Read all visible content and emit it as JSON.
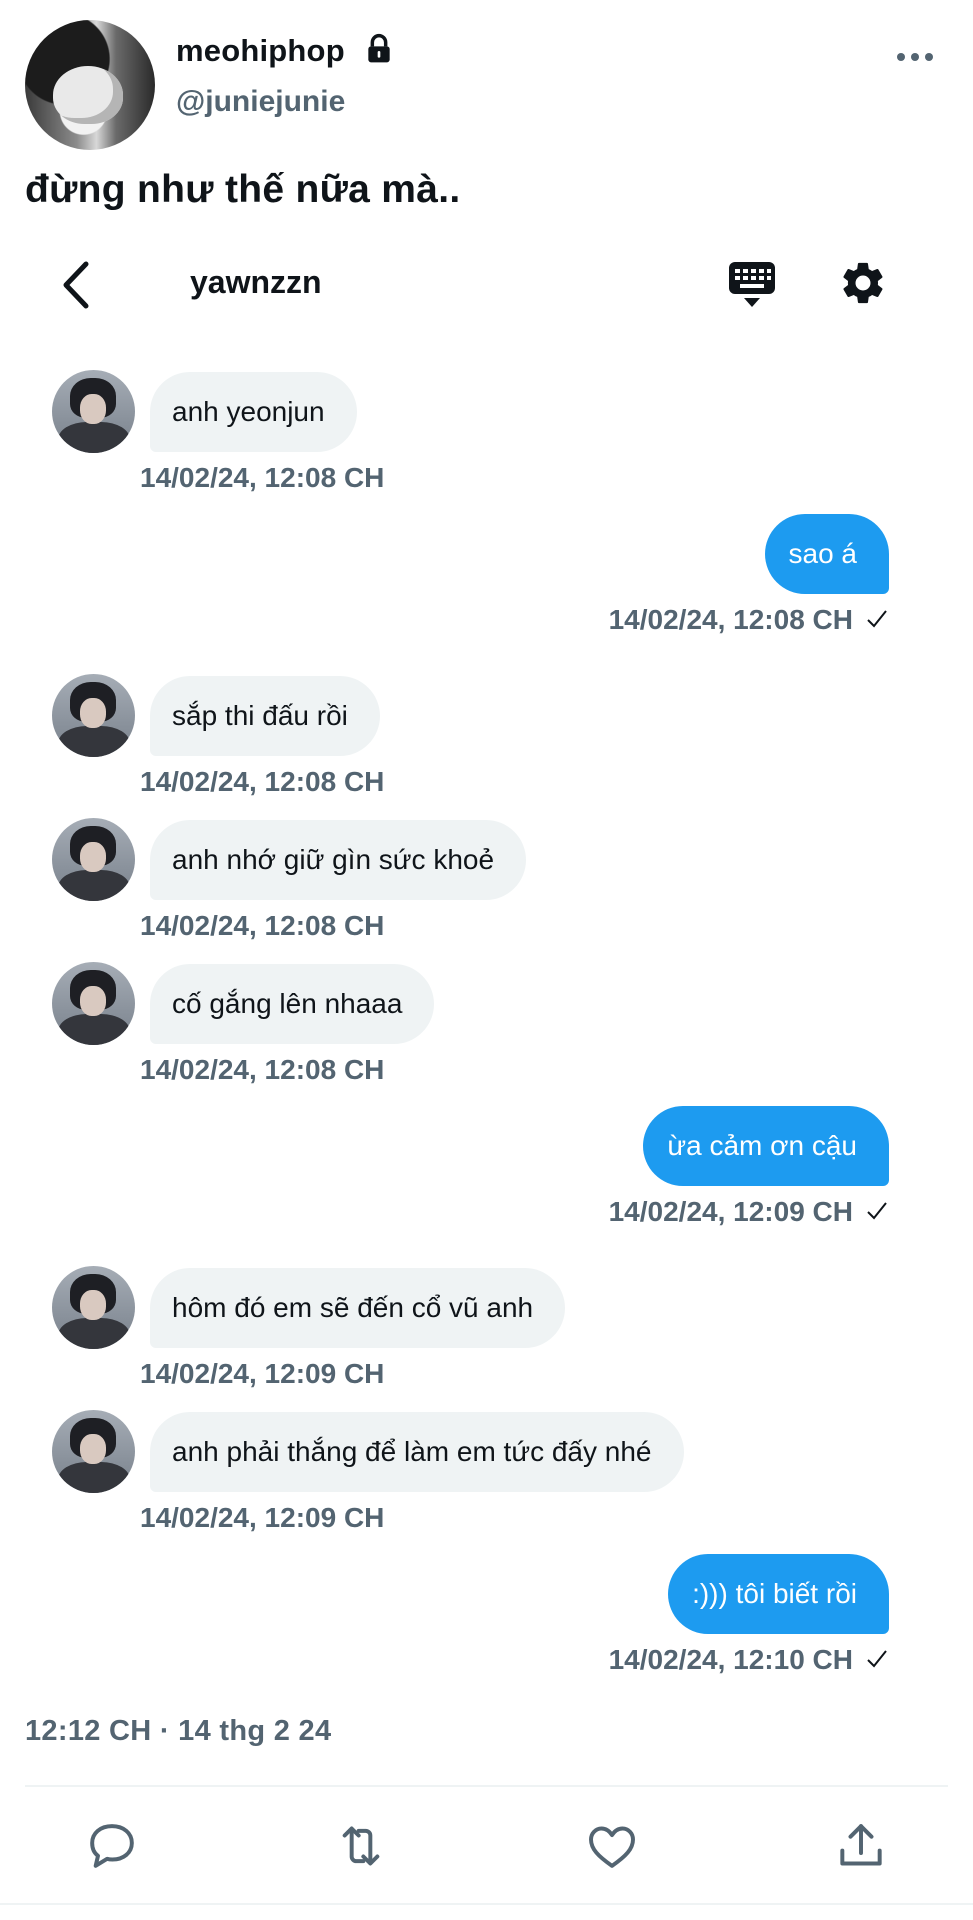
{
  "tweet": {
    "display_name": "meohiphop",
    "handle": "@juniejunie",
    "text": "đừng như thế nữa mà..",
    "timestamp": "12:12 CH · 14 thg 2 24"
  },
  "dm": {
    "title": "yawnzzn",
    "messages": [
      {
        "dir": "in",
        "text": "anh yeonjun",
        "time": "14/02/24, 12:08 CH"
      },
      {
        "dir": "out",
        "text": "sao á",
        "time": "14/02/24, 12:08 CH"
      },
      {
        "dir": "in",
        "text": "sắp thi đấu rồi",
        "time": "14/02/24, 12:08 CH"
      },
      {
        "dir": "in",
        "text": "anh nhớ giữ gìn sức khoẻ",
        "time": "14/02/24, 12:08 CH"
      },
      {
        "dir": "in",
        "text": "cố gắng lên nhaaa",
        "time": "14/02/24, 12:08 CH"
      },
      {
        "dir": "out",
        "text": "ừa cảm ơn cậu",
        "time": "14/02/24, 12:09 CH"
      },
      {
        "dir": "in",
        "text": "hôm đó em sẽ đến cổ vũ anh",
        "time": "14/02/24, 12:09 CH"
      },
      {
        "dir": "in",
        "text": "anh phải thắng để làm em tức đấy nhé",
        "time": "14/02/24, 12:09 CH"
      },
      {
        "dir": "out",
        "text": ":))) tôi biết rồi",
        "time": "14/02/24, 12:10 CH"
      }
    ]
  },
  "colors": {
    "accent": "#1d9bf0",
    "incoming_bubble": "#eff3f4",
    "secondary_text": "#536471"
  },
  "icons": [
    "lock-icon",
    "more-icon",
    "back-icon",
    "keyboard-icon",
    "gear-icon",
    "check-icon",
    "reply-icon",
    "retweet-icon",
    "like-icon",
    "share-icon"
  ]
}
